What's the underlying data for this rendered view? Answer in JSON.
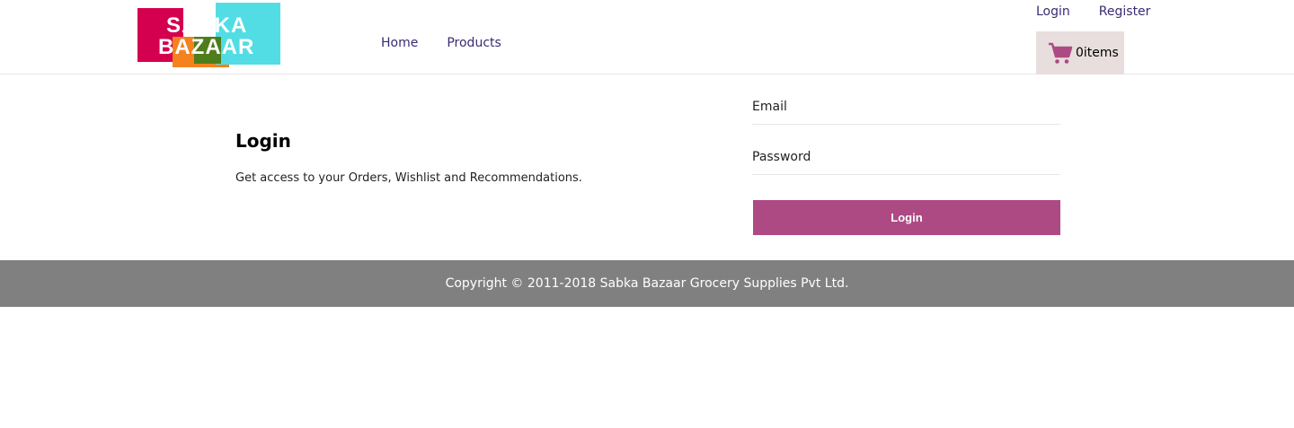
{
  "logo": {
    "line1": "SABKA",
    "line2": "BAZAAR"
  },
  "nav": {
    "home": "Home",
    "products": "Products"
  },
  "auth": {
    "login": "Login",
    "register": "Register"
  },
  "cart": {
    "icon": "cart-icon",
    "count_label": "0items"
  },
  "page": {
    "title": "Login",
    "subtitle": "Get access to your Orders, Wishlist and Recommendations."
  },
  "form": {
    "email_placeholder": "Email",
    "password_placeholder": "Password",
    "submit_label": "Login"
  },
  "footer": {
    "copyright": "Copyright © 2011-2018 Sabka Bazaar Grocery Supplies Pvt Ltd."
  },
  "colors": {
    "accent": "#ad4a83",
    "nav_text": "#3b2a73",
    "footer_bg": "#808080",
    "cart_bg": "#e8dede"
  }
}
